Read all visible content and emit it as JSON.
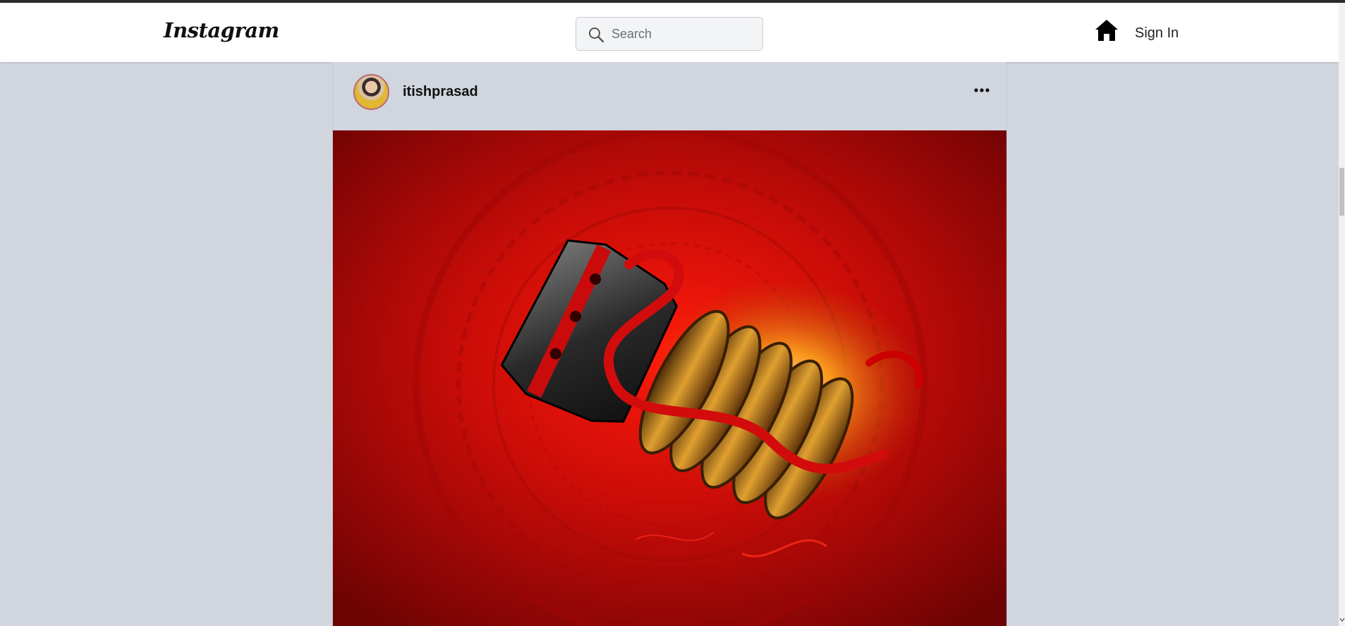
{
  "navbar": {
    "logo_text": "Instagram",
    "search_placeholder": "Search",
    "signin_label": "Sign In"
  },
  "post": {
    "username": "itishprasad",
    "image_alt": "itishprasad post"
  },
  "colors": {
    "page_background": "#d1d5dd",
    "navbar_background": "#ffffff",
    "image_primary_red": "#c20a0a",
    "image_glow": "#ffb020"
  },
  "icons": {
    "search": "search-icon",
    "home": "home-icon",
    "more": "more-options-icon"
  }
}
